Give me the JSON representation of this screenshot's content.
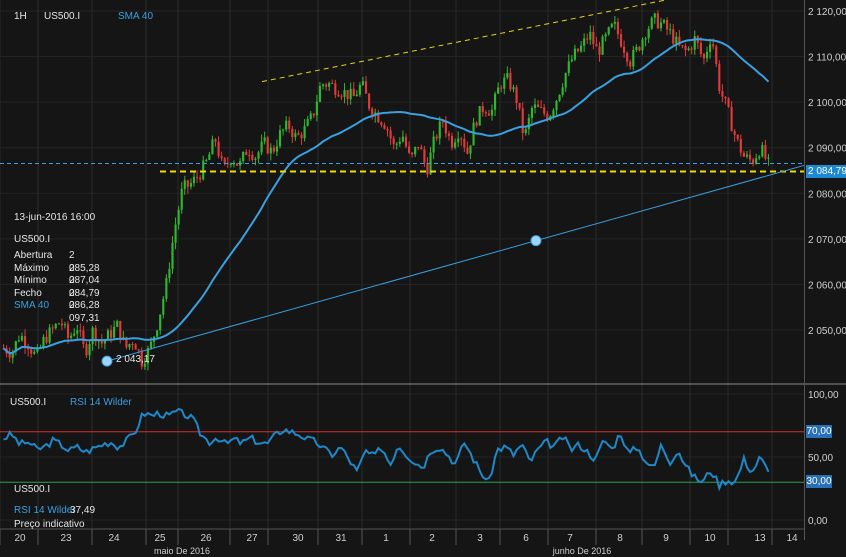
{
  "header": {
    "timeframe": "1H",
    "symbol": "US500.I",
    "indicator": "SMA 40"
  },
  "info_panel": {
    "datetime": "13-jun-2016 16:00",
    "symbol": "US500.I",
    "rows": [
      {
        "label": "Abertura",
        "value": "2 085,28"
      },
      {
        "label": "Máximo",
        "value": "2 087,04"
      },
      {
        "label": "Mínimo",
        "value": "2 084,79"
      },
      {
        "label": "Fecho",
        "value": "2 086,28"
      },
      {
        "label": "SMA 40",
        "value": "2 097,31"
      }
    ]
  },
  "price_badge": "2 084,79",
  "trend_start_label": "2 043,17",
  "lower_panel": {
    "symbol": "US500.I",
    "indicator": "RSI 14 Wilder",
    "symbol2": "US500.I",
    "indicator2": "RSI 14 Wilder",
    "indicator2_value": "37,49",
    "note": "Preço indicativo",
    "overbought_badge": "70,00",
    "oversold_badge": "30,00"
  },
  "chart_data": [
    {
      "type": "candlestick",
      "title": "",
      "ylim": [
        2040,
        2122
      ],
      "yticks": [
        "2 120,00",
        "2 110,00",
        "2 100,00",
        "2 090,00",
        "2 080,00",
        "2 070,00",
        "2 060,00",
        "2 050,00"
      ],
      "xticks": [
        "20",
        "23",
        "24",
        "25",
        "26",
        "27",
        "30",
        "31",
        "1",
        "2",
        "3",
        "6",
        "7",
        "8",
        "9",
        "10",
        "13",
        "14"
      ],
      "month_labels": [
        "maio De 2016",
        "junho De 2016"
      ],
      "sma_period": 40,
      "sma_last": 2097.31,
      "support_level": 2084.79,
      "trend_line_start": 2043.17,
      "close_path": [
        2046,
        2045,
        2049,
        2047,
        2044,
        2048,
        2050,
        2052,
        2048,
        2051,
        2045,
        2050,
        2047,
        2049,
        2051,
        2046,
        2048,
        2043.17,
        2046,
        2052,
        2060,
        2072,
        2081,
        2082,
        2084,
        2087,
        2092,
        2085,
        2088,
        2086,
        2090,
        2088,
        2091,
        2089,
        2093,
        2095,
        2092,
        2094,
        2097,
        2104,
        2104,
        2103,
        2102,
        2101,
        2104,
        2099,
        2097,
        2095,
        2090,
        2093,
        2087,
        2091,
        2085,
        2092,
        2096,
        2091,
        2094,
        2089,
        2096,
        2099,
        2098,
        2104,
        2105,
        2101,
        2092,
        2099,
        2098,
        2097,
        2101,
        2106,
        2110,
        2112,
        2115,
        2111,
        2114,
        2117,
        2113,
        2109,
        2112,
        2116,
        2118,
        2117,
        2115,
        2112,
        2111,
        2114,
        2109,
        2115,
        2103,
        2098,
        2092,
        2088,
        2087,
        2090,
        2086.28
      ]
    },
    {
      "type": "line",
      "name": "RSI 14 Wilder",
      "ylim": [
        0,
        100
      ],
      "yticks": [
        "100,00",
        "70,00",
        "50,00",
        "30,00",
        "0,00"
      ],
      "overbought": 70,
      "oversold": 30,
      "last": 37.49,
      "values": [
        65,
        68,
        60,
        62,
        56,
        58,
        63,
        60,
        55,
        58,
        54,
        57,
        60,
        62,
        58,
        63,
        70,
        85,
        83,
        85,
        82,
        86,
        84,
        80,
        68,
        62,
        66,
        60,
        64,
        61,
        65,
        62,
        60,
        67,
        72,
        70,
        68,
        64,
        62,
        56,
        52,
        58,
        48,
        38,
        55,
        50,
        58,
        44,
        60,
        52,
        46,
        42,
        56,
        58,
        52,
        44,
        62,
        50,
        38,
        30,
        56,
        58,
        52,
        60,
        46,
        56,
        62,
        58,
        66,
        56,
        60,
        54,
        48,
        64,
        56,
        70,
        52,
        58,
        48,
        40,
        60,
        46,
        56,
        42,
        34,
        30,
        40,
        28,
        32,
        30,
        48,
        38,
        50,
        37.49
      ]
    }
  ]
}
